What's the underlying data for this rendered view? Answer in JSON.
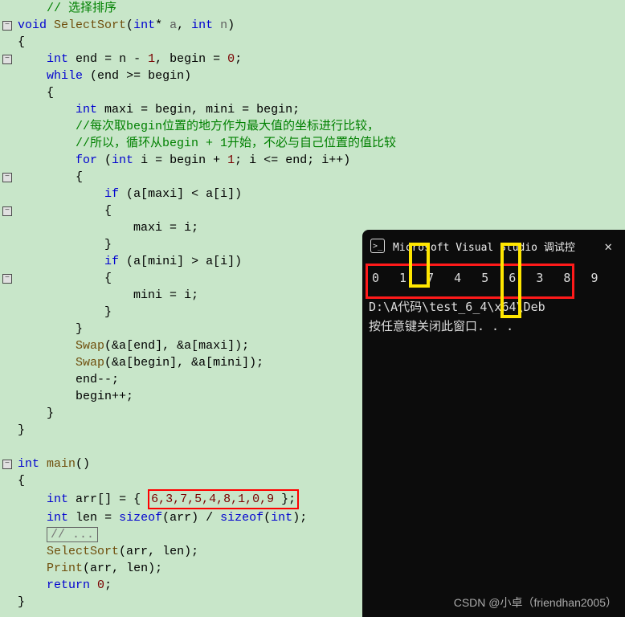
{
  "code": {
    "c1": "// 选择排序",
    "l2a": "void",
    "l2b": "SelectSort",
    "l2c": "int",
    "l2d": "a",
    "l2e": "int",
    "l2f": "n",
    "l3": "{",
    "l4a": "int",
    "l4b": "end",
    "l4c": "n",
    "l4d": "1",
    "l4e": "begin",
    "l4f": "0",
    "l5a": "while",
    "l5b": "end",
    "l5c": "begin",
    "l6": "{",
    "l7a": "int",
    "l7b": "maxi",
    "l7c": "begin",
    "l7d": "mini",
    "l7e": "begin",
    "c8": "//每次取begin位置的地方作为最大值的坐标进行比较，",
    "c9": "//所以，循环从begin + 1开始，不必与自己位置的值比较",
    "l10a": "for",
    "l10b": "int",
    "l10c": "i",
    "l10d": "begin",
    "l10e": "1",
    "l10f": "i",
    "l10g": "end",
    "l10h": "i",
    "l11": "{",
    "l12a": "if",
    "l12b": "a",
    "l12c": "maxi",
    "l12d": "a",
    "l12e": "i",
    "l13": "{",
    "l14a": "maxi",
    "l14b": "i",
    "l15": "}",
    "l16a": "if",
    "l16b": "a",
    "l16c": "mini",
    "l16d": "a",
    "l16e": "i",
    "l17": "{",
    "l18a": "mini",
    "l18b": "i",
    "l19": "}",
    "l20": "}",
    "l21a": "Swap",
    "l21b": "a",
    "l21c": "end",
    "l21d": "a",
    "l21e": "maxi",
    "l22a": "Swap",
    "l22b": "a",
    "l22c": "begin",
    "l22d": "a",
    "l22e": "mini",
    "l23a": "end",
    "l24a": "begin",
    "l25": "}",
    "l26": "}",
    "l28a": "int",
    "l28b": "main",
    "l29": "{",
    "l30a": "int",
    "l30b": "arr",
    "l30c": "6,3,7,5,4,8,1,0,9",
    "l31a": "int",
    "l31b": "len",
    "l31c": "sizeof",
    "l31d": "arr",
    "l31e": "sizeof",
    "l31f": "int",
    "l32": "// ...",
    "l33a": "SelectSort",
    "l33b": "arr",
    "l33c": "len",
    "l34a": "Print",
    "l34b": "arr",
    "l34c": "len",
    "l35a": "return",
    "l35b": "0",
    "l36": "}"
  },
  "terminal": {
    "title": "Microsoft Visual Studio 调试控",
    "output": "0 1 7 4 5 6 3 8 9",
    "path": "D:\\A代码\\test_6_4\\x64\\Deb",
    "prompt": "按任意键关闭此窗口. . ."
  },
  "watermark": "CSDN @小卓（friendhan2005）",
  "icons": {
    "collapse": "−",
    "terminal": ">_",
    "close": "✕"
  }
}
